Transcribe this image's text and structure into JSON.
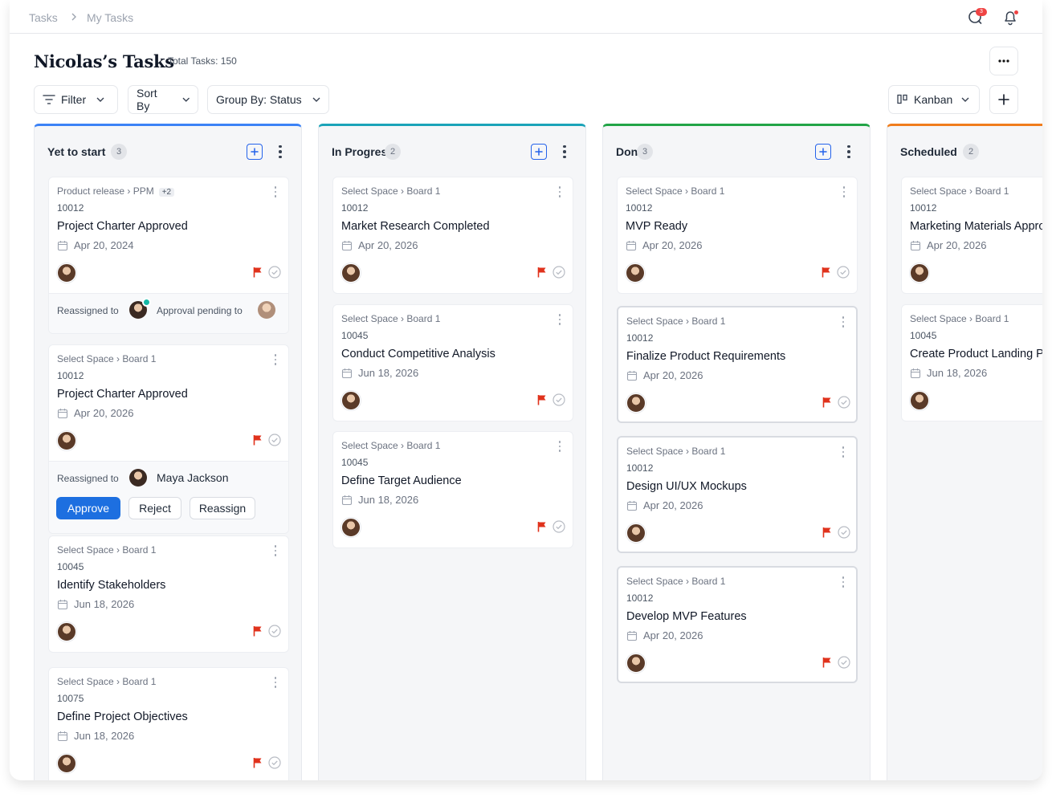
{
  "breadcrumb": {
    "root": "Tasks",
    "current": "My Tasks"
  },
  "notifications": {
    "badge_count": "3"
  },
  "header": {
    "title": "Nicolas’s Tasks",
    "total_tasks": "Total Tasks: 150"
  },
  "toolbar": {
    "filter": "Filter",
    "sort": "Sort By",
    "group": "Group By: Status",
    "view": "Kanban"
  },
  "columns": [
    {
      "title": "Yet to start",
      "count": "3",
      "accent": "#3b82f6",
      "cards": [
        {
          "path": "Product release  ›  PPM",
          "extra": "+2",
          "id": "10012",
          "title": "Project Charter Approved",
          "date": "Apr 20, 2024",
          "footer": {
            "reassigned_label": "Reassigned to",
            "pending_label": "Approval pending to"
          }
        },
        {
          "path": "Select Space  ›  Board 1",
          "id": "10012",
          "title": "Project Charter Approved",
          "date": "Apr 20, 2026",
          "footer": {
            "reassigned_label": "Reassigned to",
            "person": "Maya Jackson",
            "approve": "Approve",
            "reject": "Reject",
            "reassign": "Reassign"
          }
        },
        {
          "path": "Select Space  ›  Board 1",
          "id": "10045",
          "title": "Identify Stakeholders",
          "date": "Jun 18, 2026"
        },
        {
          "path": "Select Space  ›  Board 1",
          "id": "10075",
          "title": "Define Project Objectives",
          "date": "Jun 18, 2026"
        }
      ]
    },
    {
      "title": "In Progress",
      "count": "2",
      "accent": "#1aa3b8",
      "cards": [
        {
          "path": "Select Space  ›  Board 1",
          "id": "10012",
          "title": "Market Research Completed",
          "date": "Apr 20, 2026"
        },
        {
          "path": "Select Space  ›  Board 1",
          "id": "10045",
          "title": "Conduct Competitive Analysis",
          "date": "Jun 18, 2026"
        },
        {
          "path": "Select Space  ›  Board 1",
          "id": "10045",
          "title": "Define Target Audience",
          "date": "Jun 18, 2026"
        }
      ]
    },
    {
      "title": "Done",
      "count": "3",
      "accent": "#22a447",
      "cards": [
        {
          "path": "Select Space  ›  Board 1",
          "id": "10012",
          "title": " MVP Ready",
          "date": "Apr 20, 2026"
        },
        {
          "path": "Select Space  ›  Board 1",
          "id": "10012",
          "title": "Finalize Product Requirements",
          "date": "Apr 20, 2026"
        },
        {
          "path": "Select Space  ›  Board 1",
          "id": "10012",
          "title": "Design UI/UX Mockups",
          "date": "Apr 20, 2026"
        },
        {
          "path": "Select Space  ›  Board 1",
          "id": "10012",
          "title": "Develop MVP Features",
          "date": "Apr 20, 2026"
        }
      ]
    },
    {
      "title": "Scheduled",
      "count": "2",
      "accent": "#f07d1c",
      "cards": [
        {
          "path": "Select Space  ›  Board 1",
          "id": "10012",
          "title": "Marketing Materials Approved",
          "date": "Apr 20, 2026"
        },
        {
          "path": "Select Space  ›  Board 1",
          "id": "10045",
          "title": "Create Product Landing Page",
          "date": "Jun 18, 2026"
        }
      ]
    }
  ],
  "colors": {
    "primary": "#1d6fe0",
    "flag": "#e0321c",
    "page_bg": "#f5f6f8"
  }
}
